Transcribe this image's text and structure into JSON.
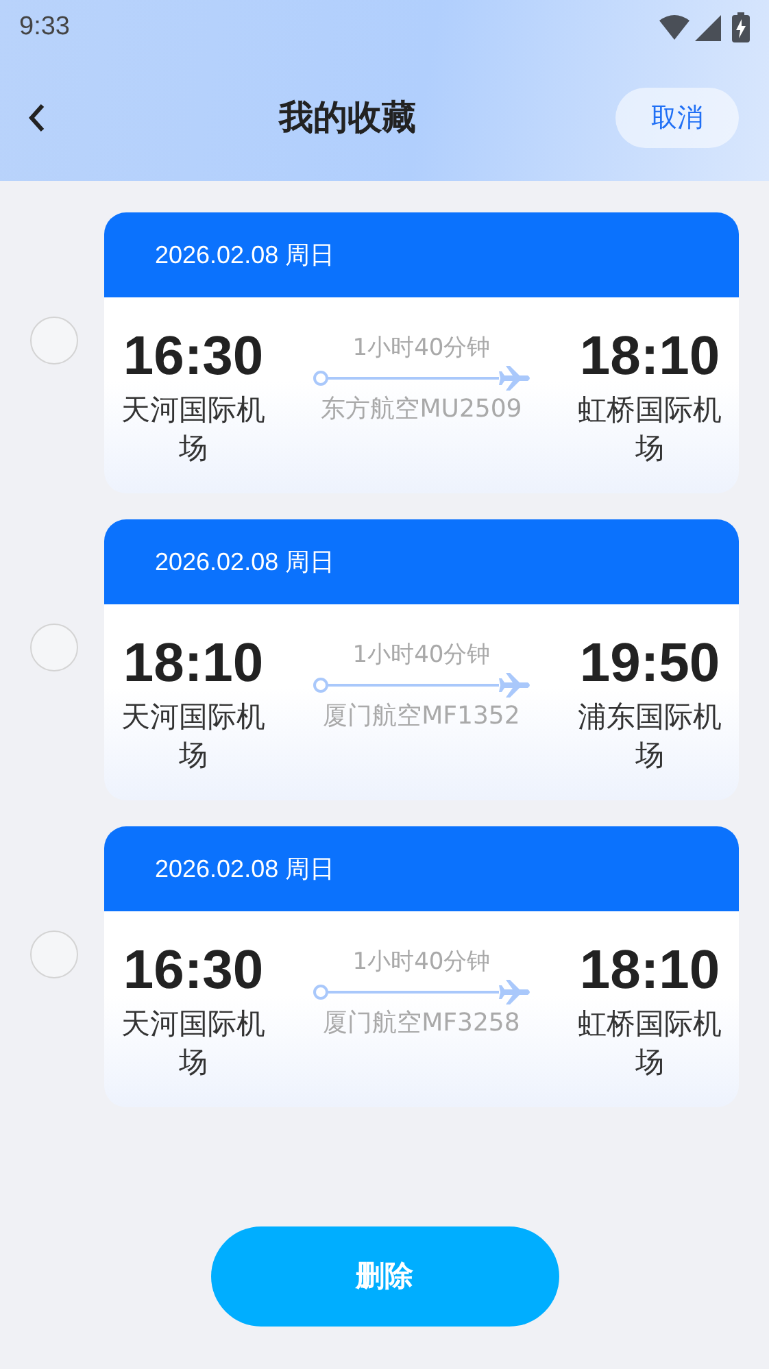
{
  "status_bar": {
    "time": "9:33"
  },
  "header": {
    "title": "我的收藏",
    "cancel": "取消"
  },
  "flights": [
    {
      "date": "2026.02.08 周日",
      "selected": false,
      "depart_time": "16:30",
      "depart_airport": "天河国际机场",
      "duration": "1小时40分钟",
      "airline": "东方航空MU2509",
      "arrive_time": "18:10",
      "arrive_airport": "虹桥国际机场"
    },
    {
      "date": "2026.02.08 周日",
      "selected": false,
      "depart_time": "18:10",
      "depart_airport": "天河国际机场",
      "duration": "1小时40分钟",
      "airline": "厦门航空MF1352",
      "arrive_time": "19:50",
      "arrive_airport": "浦东国际机场"
    },
    {
      "date": "2026.02.08 周日",
      "selected": false,
      "depart_time": "16:30",
      "depart_airport": "天河国际机场",
      "duration": "1小时40分钟",
      "airline": "厦门航空MF3258",
      "arrive_time": "18:10",
      "arrive_airport": "虹桥国际机场"
    }
  ],
  "delete_button": "删除"
}
